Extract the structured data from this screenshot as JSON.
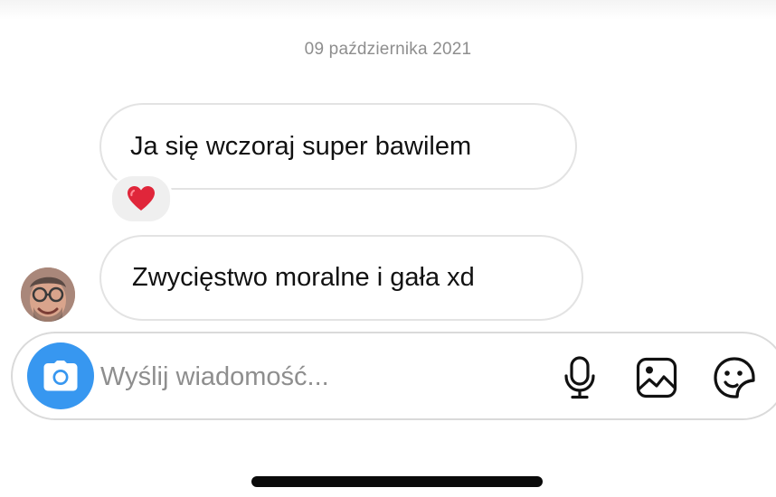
{
  "thread": {
    "date_separator": "09 października 2021"
  },
  "messages": [
    {
      "text": "Ja się wczoraj super bawilem",
      "reaction": "heart-emoji"
    },
    {
      "text": "Zwycięstwo moralne i gała xd"
    }
  ],
  "composer": {
    "placeholder": "Wyślij wiadomość...",
    "value": "",
    "icons": [
      "camera-icon",
      "microphone-icon",
      "gallery-icon",
      "sticker-icon"
    ]
  },
  "colors": {
    "accent": "#3797f0",
    "bubble_border": "#e3e3e3",
    "reaction_bg": "#efefef",
    "heart": "#e0263a"
  }
}
